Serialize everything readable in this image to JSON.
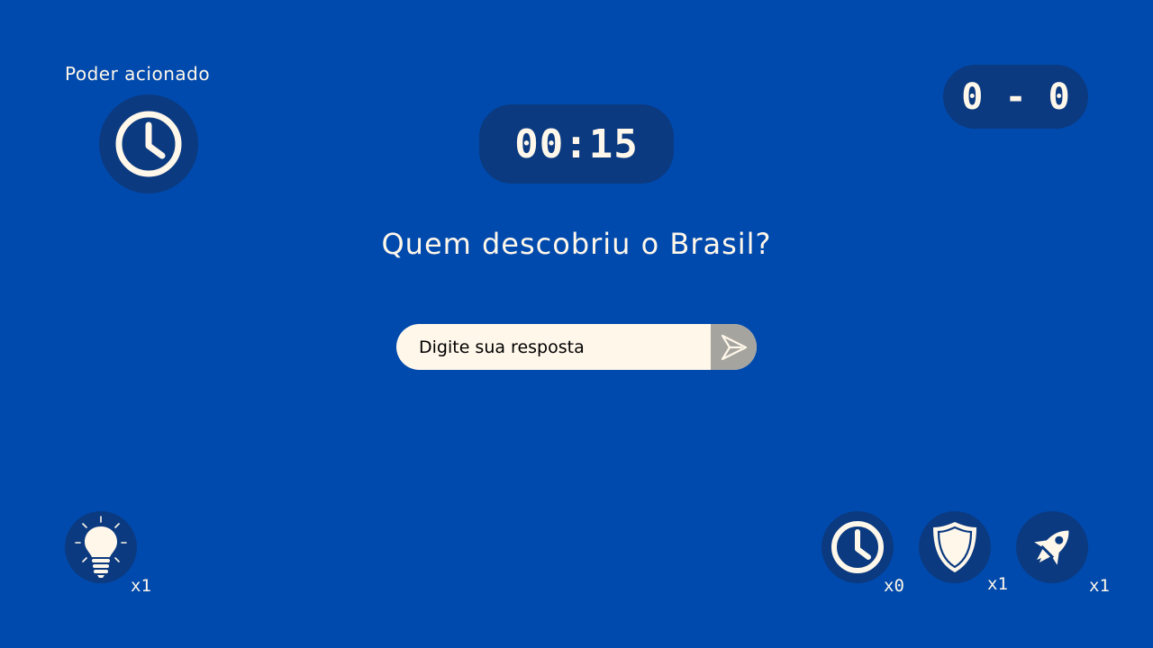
{
  "active_power": {
    "label": "Poder acionado",
    "icon": "clock-icon"
  },
  "timer": {
    "value": "00:15"
  },
  "score": {
    "value": "0 - 0"
  },
  "question": {
    "text": "Quem descobriu o Brasil?"
  },
  "answer": {
    "placeholder": "Digite sua resposta",
    "value": "",
    "send_icon": "send-icon"
  },
  "powers": [
    {
      "name": "hint",
      "icon": "lightbulb-icon",
      "count": "x1"
    },
    {
      "name": "time",
      "icon": "clock-icon",
      "count": "x0"
    },
    {
      "name": "shield",
      "icon": "shield-icon",
      "count": "x1"
    },
    {
      "name": "boost",
      "icon": "rocket-icon",
      "count": "x1"
    }
  ],
  "colors": {
    "background": "#004aad",
    "pill": "#0b3a80",
    "text": "#fff7ea",
    "send_button": "#a6a49f"
  }
}
